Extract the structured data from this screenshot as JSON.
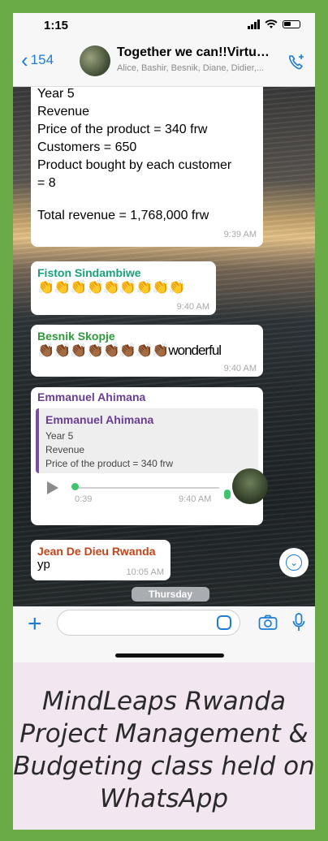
{
  "status_bar": {
    "time": "1:15"
  },
  "header": {
    "back_count": "154",
    "group_title": "Together we can!!Virtual...",
    "members": "Alice, Bashir, Besnik, Diane, Didier,..."
  },
  "messages": {
    "m1": {
      "lines": [
        "Year 5",
        "Revenue",
        "Price of the product = 340 frw",
        "Customers = 650",
        "Product bought by each customer",
        "= 8"
      ],
      "total": "Total revenue = 1,768,000 frw",
      "time": "9:39 AM"
    },
    "m2": {
      "sender": "Fiston Sindambiwe",
      "sender_color": "#1aa179",
      "text": "👏👏👏👏👏👏👏👏👏",
      "time": "9:40 AM"
    },
    "m3": {
      "sender": "Besnik Skopje",
      "sender_color": "#2e9a3a",
      "text": "👏🏾👏🏾👏🏾👏🏾👏🏾👏🏾👏🏾👏🏾wonderful",
      "time": "9:40 AM"
    },
    "m4": {
      "sender": "Emmanuel Ahimana",
      "sender_color": "#6a3e92",
      "quote_sender": "Emmanuel Ahimana",
      "quote_lines": [
        "Year 5",
        "Revenue",
        "Price of the product = 340 frw"
      ],
      "duration": "0:39",
      "time": "9:40 AM"
    },
    "m5": {
      "sender": "Jean De Dieu  Rwanda",
      "sender_color": "#c0451b",
      "text": "yp",
      "time": "10:05 AM"
    }
  },
  "day_separator": "Thursday",
  "caption": "MindLeaps Rwanda Project Management & Budgeting class held on WhatsApp",
  "colors": {
    "frame": "#6bab47",
    "accent": "#1c7cd6",
    "background": "#f2e6f0"
  }
}
